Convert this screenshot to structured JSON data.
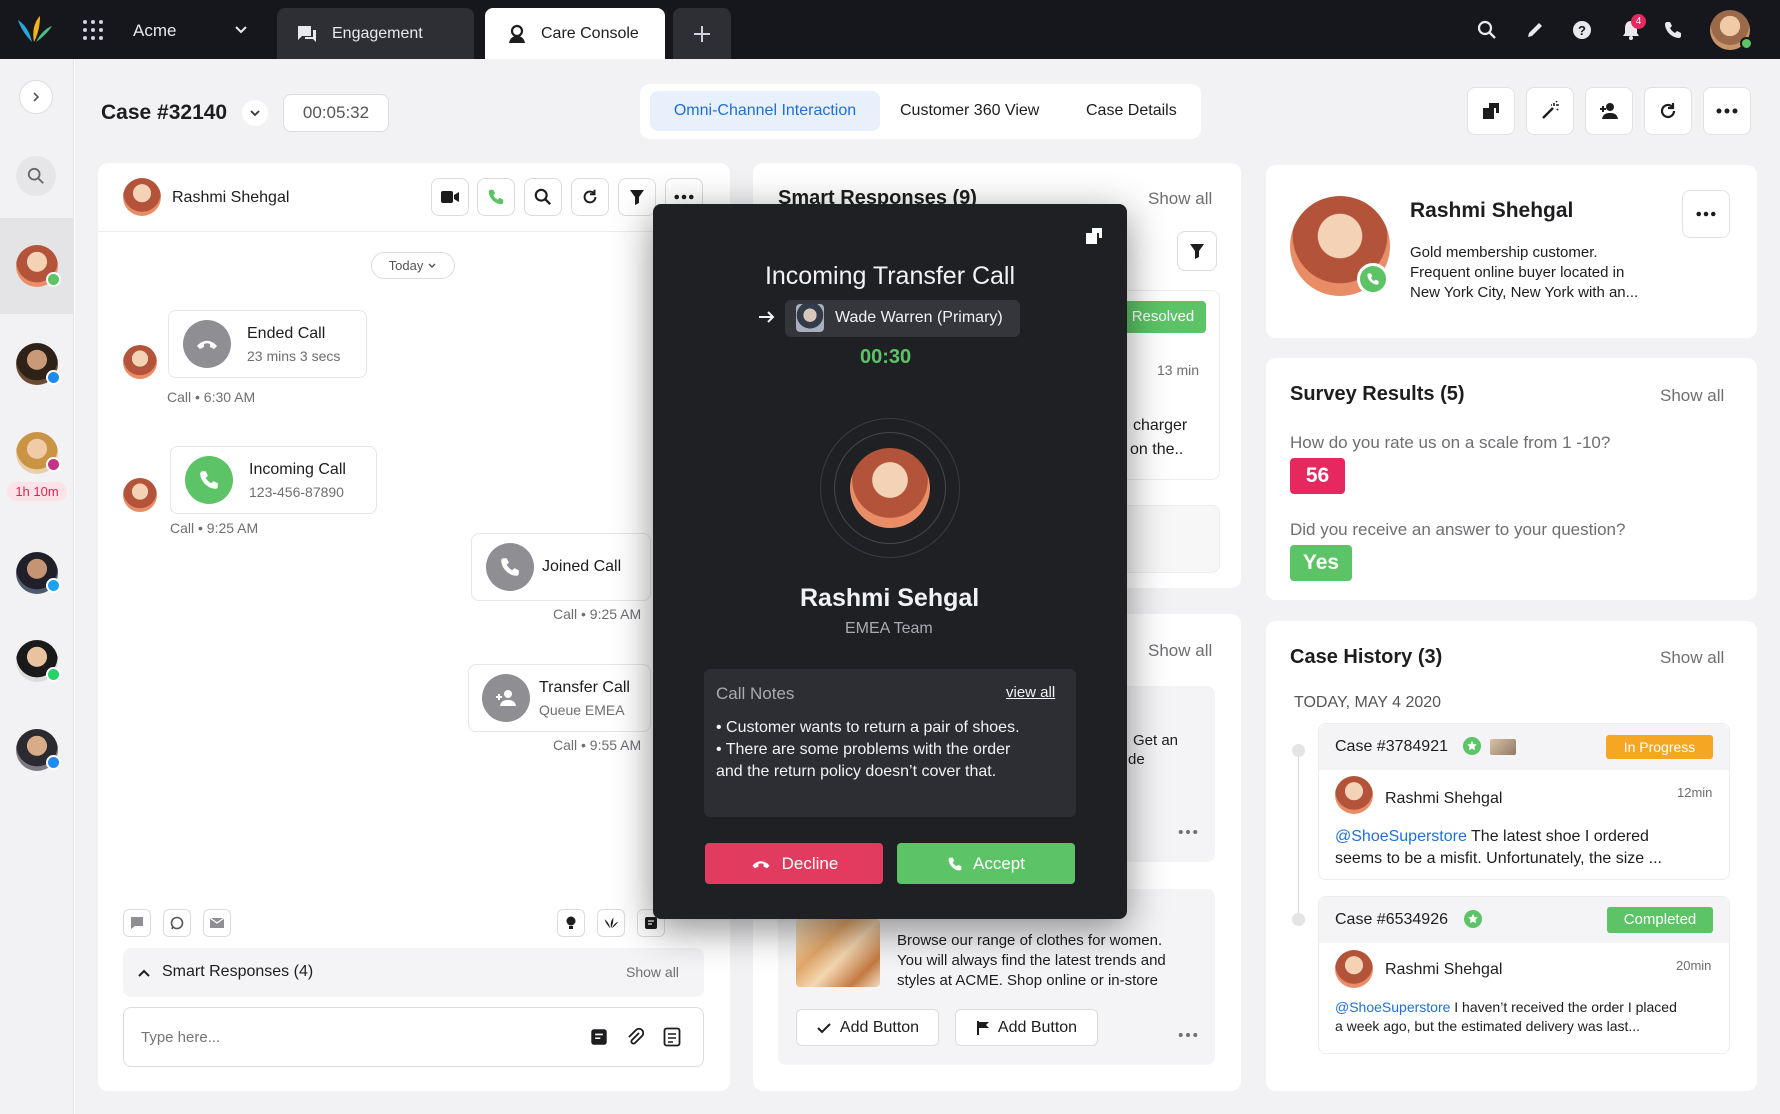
{
  "topbar": {
    "workspace": "Acme",
    "tabs": [
      {
        "label": "Engagement",
        "active": false
      },
      {
        "label": "Care Console",
        "active": true
      }
    ],
    "notification_count": "4"
  },
  "case": {
    "title": "Case #32140",
    "timer": "00:05:32",
    "view_tabs": [
      "Omni-Channel Interaction",
      "Customer 360 View",
      "Case Details"
    ]
  },
  "sidebar": {
    "wait_time": "1h 10m"
  },
  "conversation": {
    "contact_name": "Rashmi Shehgal",
    "date_filter": "Today",
    "events": [
      {
        "title": "Ended Call",
        "subtitle": "23 mins 3 secs",
        "meta": "Call • 6:30 AM"
      },
      {
        "title": "Incoming Call",
        "subtitle": "123-456-87890",
        "meta": "Call • 9:25 AM"
      },
      {
        "title": "Joined Call",
        "subtitle": "",
        "meta": "Call • 9:25 AM"
      },
      {
        "title": "Transfer Call",
        "subtitle": "Queue EMEA",
        "meta": "Call • 9:55 AM"
      }
    ],
    "smart_responses_label": "Smart Responses (4)",
    "smart_responses_showall": "Show all",
    "composer_placeholder": "Type here..."
  },
  "middle": {
    "smart_responses_title": "Smart Responses (9)",
    "show_all": "Show all",
    "status_resolved": "Resolved",
    "time_13": "13 min",
    "snippet1_line1": "charger",
    "snippet1_line2": "on the..",
    "show_all_2": "Show all",
    "snippet2_line1": "Get an",
    "snippet2_line2": "de",
    "product_text_lines": [
      "Browse our range of clothes for women.",
      "You will always find the latest trends and",
      "styles at ACME. Shop online or in-store"
    ],
    "add_button_1": "Add Button",
    "add_button_2": "Add Button"
  },
  "modal": {
    "title": "Incoming Transfer Call",
    "from_agent": "Wade Warren (Primary)",
    "timer": "00:30",
    "caller_name": "Rashmi Sehgal",
    "caller_team": "EMEA Team",
    "notes_title": "Call Notes",
    "notes_link": "view all",
    "notes": [
      "• Customer wants to return a pair of shoes.",
      "• There are some problems with the order",
      "and the return policy doesn’t cover that."
    ],
    "decline_label": "Decline",
    "accept_label": "Accept"
  },
  "profile": {
    "name": "Rashmi Shehgal",
    "description_lines": [
      "Gold membership customer.",
      "Frequent online buyer located in",
      "New York City, New York with an..."
    ]
  },
  "survey": {
    "title": "Survey Results (5)",
    "show_all": "Show all",
    "q1": "How do you rate us on a scale from 1 -10?",
    "a1": "56",
    "q2": "Did you receive an answer to your question?",
    "a2": "Yes"
  },
  "history": {
    "title": "Case History (3)",
    "show_all": "Show all",
    "date": "TODAY, MAY 4 2020",
    "cases": [
      {
        "id": "Case #3784921",
        "status": "In Progress",
        "author": "Rashmi Shehgal",
        "time": "12min",
        "handle": "@ShoeSuperstore",
        "line1": " The latest shoe I ordered",
        "line2": "seems to be a misfit. Unfortunately, the size ..."
      },
      {
        "id": "Case #6534926",
        "status": "Completed",
        "author": "Rashmi Shehgal",
        "time": "20min",
        "handle": "@ShoeSuperstore",
        "line1": " I haven’t received the order I placed",
        "line2": "a week ago, but the estimated delivery was last..."
      }
    ]
  },
  "colors": {
    "accent": "#1f6fd6",
    "green": "#5cc466",
    "decline": "#e13b5f",
    "score": "#e6285f",
    "orange": "#f5a623"
  }
}
